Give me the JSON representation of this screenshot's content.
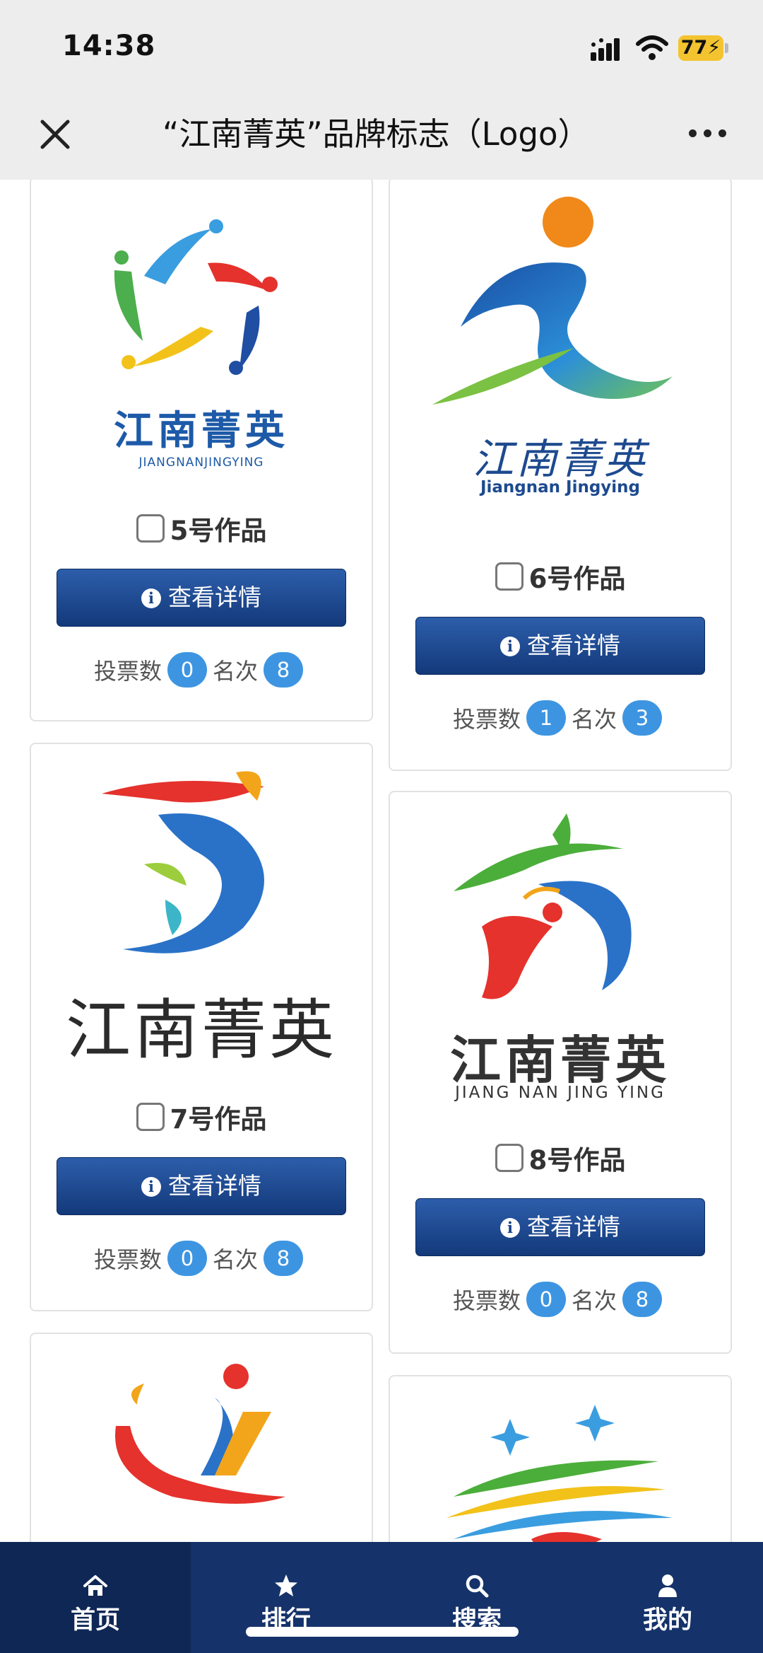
{
  "status": {
    "time": "14:38",
    "battery": "77"
  },
  "nav": {
    "title": "“江南菁英”品牌标志（Logo）"
  },
  "icons": {
    "close": "close-icon",
    "more": "more-icon",
    "signal": "signal-icon",
    "wifi": "wifi-icon",
    "info": "info-icon",
    "home": "home-icon",
    "star": "star-icon",
    "search": "search-icon",
    "user": "user-icon"
  },
  "colors": {
    "accent": "#1d4a8f",
    "pill": "#3d95e2",
    "tabbar": "#15326a",
    "battery": "#f4c430"
  },
  "entries": [
    {
      "brand_cn": "江南菁英",
      "brand_en": "JIANGNANJINGYING",
      "work": "5号作品",
      "button": "查看详情",
      "votes_label": "投票数",
      "votes": "0",
      "rank_label": "名次",
      "rank": "8"
    },
    {
      "brand_cn": "江南菁英",
      "brand_en": "Jiangnan Jingying",
      "work": "6号作品",
      "button": "查看详情",
      "votes_label": "投票数",
      "votes": "1",
      "rank_label": "名次",
      "rank": "3"
    },
    {
      "brand_cn": "江南菁英",
      "work": "7号作品",
      "button": "查看详情",
      "votes_label": "投票数",
      "votes": "0",
      "rank_label": "名次",
      "rank": "8"
    },
    {
      "brand_cn": "江南菁英",
      "brand_en": "JIANG NAN JING YING",
      "work": "8号作品",
      "button": "查看详情",
      "votes_label": "投票数",
      "votes": "0",
      "rank_label": "名次",
      "rank": "8"
    }
  ],
  "tabs": [
    {
      "label": "首页",
      "icon": "home-icon",
      "active": true
    },
    {
      "label": "排行",
      "icon": "star-icon",
      "active": false
    },
    {
      "label": "搜索",
      "icon": "search-icon",
      "active": false
    },
    {
      "label": "我的",
      "icon": "user-icon",
      "active": false
    }
  ]
}
